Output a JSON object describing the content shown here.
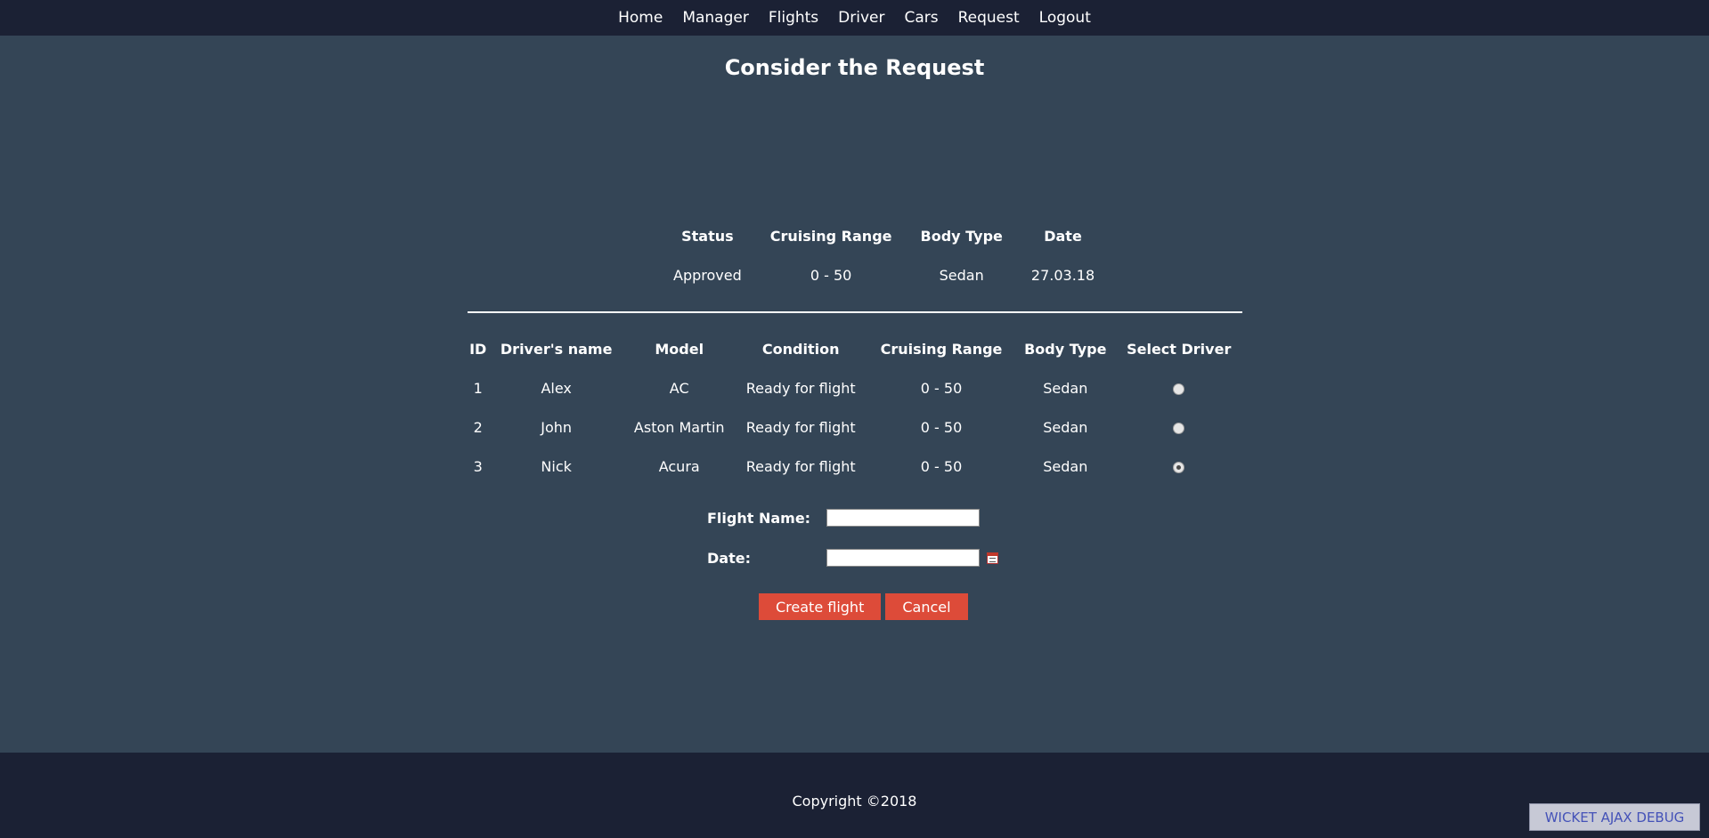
{
  "nav": {
    "items": [
      "Home",
      "Manager",
      "Flights",
      "Driver",
      "Cars",
      "Request",
      "Logout"
    ]
  },
  "page": {
    "title": "Consider the Request"
  },
  "request": {
    "headers": [
      "Status",
      "Cruising Range",
      "Body Type",
      "Date"
    ],
    "values": [
      "Approved",
      "0 - 50",
      "Sedan",
      "27.03.18"
    ]
  },
  "drivers": {
    "headers": [
      "ID",
      "Driver's name",
      "Model",
      "Condition",
      "Cruising Range",
      "Body Type",
      "Select Driver"
    ],
    "rows": [
      {
        "id": "1",
        "name": "Alex",
        "model": "AC",
        "condition": "Ready for flight",
        "range": "0 - 50",
        "body": "Sedan",
        "selected": false
      },
      {
        "id": "2",
        "name": "John",
        "model": "Aston Martin",
        "condition": "Ready for flight",
        "range": "0 - 50",
        "body": "Sedan",
        "selected": false
      },
      {
        "id": "3",
        "name": "Nick",
        "model": "Acura",
        "condition": "Ready for flight",
        "range": "0 - 50",
        "body": "Sedan",
        "selected": true
      }
    ]
  },
  "form": {
    "flight_name_label": "Flight Name:",
    "flight_name_value": "",
    "date_label": "Date:",
    "date_value": "",
    "create_label": "Create flight",
    "cancel_label": "Cancel"
  },
  "footer": {
    "copyright": "Copyright ©2018",
    "debug_label": "WICKET AJAX DEBUG"
  },
  "colors": {
    "nav_bg": "#1b2134",
    "main_bg": "#344556",
    "button": "#dd4b39"
  },
  "icons": {
    "date_picker": "calendar-icon"
  }
}
